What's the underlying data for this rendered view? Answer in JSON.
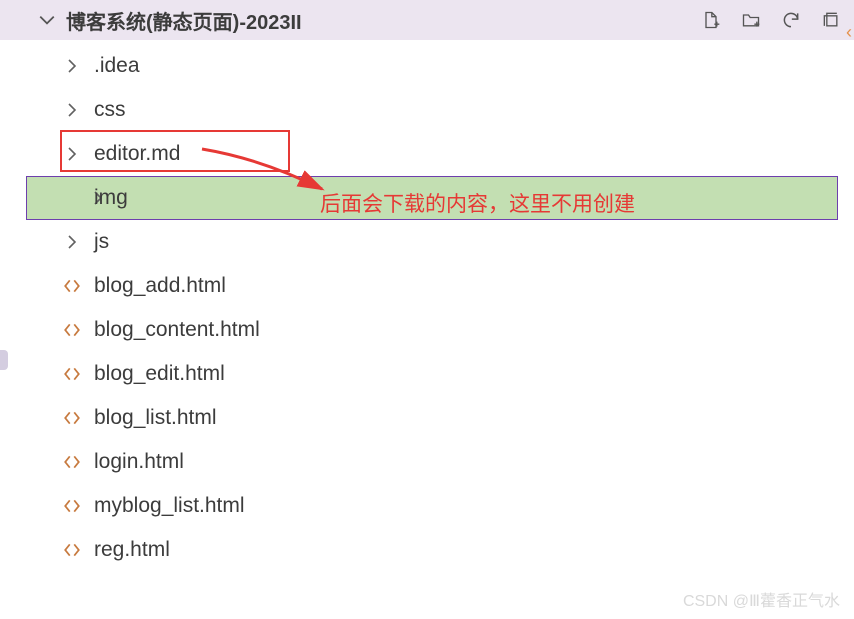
{
  "header": {
    "title": "博客系统(静态页面)-2023II"
  },
  "tree": {
    "folders": [
      {
        "name": ".idea"
      },
      {
        "name": "css"
      },
      {
        "name": "editor.md",
        "boxed": true
      },
      {
        "name": "img",
        "highlighted": true
      },
      {
        "name": "js"
      }
    ],
    "files": [
      {
        "name": "blog_add.html"
      },
      {
        "name": "blog_content.html"
      },
      {
        "name": "blog_edit.html"
      },
      {
        "name": "blog_list.html"
      },
      {
        "name": "login.html"
      },
      {
        "name": "myblog_list.html"
      },
      {
        "name": "reg.html"
      }
    ]
  },
  "annotation": "后面会下载的内容，这里不用创建",
  "watermark": "CSDN @Ⅲ藿香正气水"
}
